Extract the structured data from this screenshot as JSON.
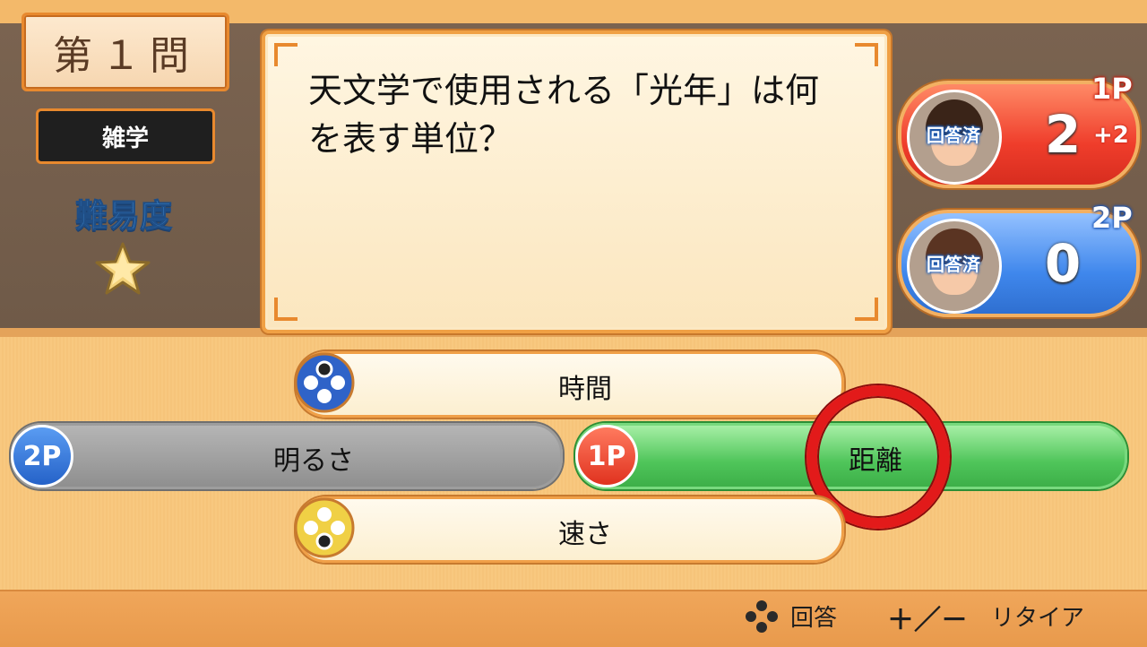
{
  "question": {
    "number_label": "第１問",
    "category": "雑学",
    "difficulty_label": "難易度",
    "difficulty_stars": 1,
    "text_line1": "天文学で使用される「光年」は何",
    "text_line2": "を表す単位？"
  },
  "players": [
    {
      "tag": "1P",
      "status": "回答済",
      "score": "2",
      "delta": "+2",
      "color": "#ef3d2b"
    },
    {
      "tag": "2P",
      "status": "回答済",
      "score": "0",
      "color": "#3f87ec"
    }
  ],
  "answers": {
    "top": "時間",
    "left": "明るさ",
    "right": "距離",
    "bottom": "速さ",
    "left_chooser": "2P",
    "right_chooser": "1P"
  },
  "footer": {
    "answer_label": "回答",
    "plus_minus": "＋／－",
    "retire_label": "リタイア"
  },
  "colors": {
    "correct_ring": "#e21a1a",
    "accent_orange": "#e8892e"
  }
}
